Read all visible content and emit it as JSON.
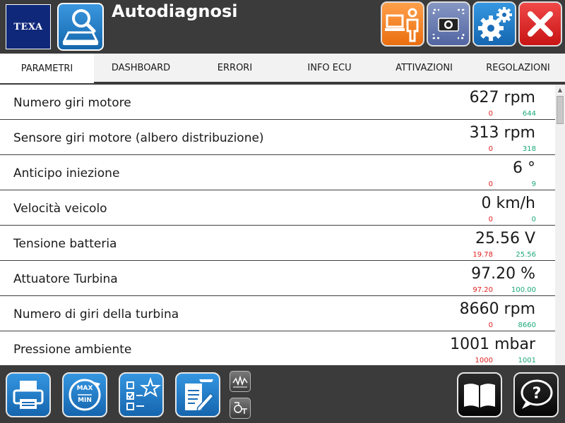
{
  "header": {
    "logo_text": "TEXA",
    "title": "Autodiagnosi",
    "icons": [
      "search-car-icon",
      "person-laptop-icon",
      "camera-screenshot-icon",
      "gear-icon",
      "close-icon"
    ]
  },
  "tabs": [
    {
      "label": "PARAMETRI",
      "active": true
    },
    {
      "label": "DASHBOARD",
      "active": false
    },
    {
      "label": "ERRORI",
      "active": false
    },
    {
      "label": "INFO ECU",
      "active": false
    },
    {
      "label": "ATTIVAZIONI",
      "active": false
    },
    {
      "label": "REGOLAZIONI",
      "active": false
    }
  ],
  "parameters": [
    {
      "name": "Numero giri motore",
      "value": "627 rpm",
      "min": "0",
      "max": "644"
    },
    {
      "name": "Sensore giri motore (albero distribuzione)",
      "value": "313 rpm",
      "min": "0",
      "max": "318"
    },
    {
      "name": "Anticipo iniezione",
      "value": "6 °",
      "min": "0",
      "max": "9"
    },
    {
      "name": "Velocità veicolo",
      "value": "0 km/h",
      "min": "0",
      "max": "0"
    },
    {
      "name": "Tensione batteria",
      "value": "25.56 V",
      "min": "19.78",
      "max": "25.56"
    },
    {
      "name": "Attuatore Turbina",
      "value": "97.20 %",
      "min": "97.20",
      "max": "100.00"
    },
    {
      "name": "Numero di giri della turbina",
      "value": "8660 rpm",
      "min": "0",
      "max": "8660"
    },
    {
      "name": "Pressione ambiente",
      "value": "1001 mbar",
      "min": "1000",
      "max": "1001"
    }
  ],
  "footer": {
    "icons": [
      "printer-icon",
      "max-min-reset-icon",
      "checklist-star-icon",
      "report-edit-icon",
      "signal-graph-icon",
      "network-settings-icon",
      "manual-book-icon",
      "help-icon"
    ],
    "max_label": "MAX",
    "min_label": "MIN"
  },
  "colors": {
    "header_bg": "#3b3b3b",
    "min_value": "#e02020",
    "max_value": "#1aa878",
    "blue_button": "#1f7fcf",
    "orange_button": "#f28a2e",
    "close_button": "#e02a2a",
    "logo_bg": "#10287a"
  }
}
